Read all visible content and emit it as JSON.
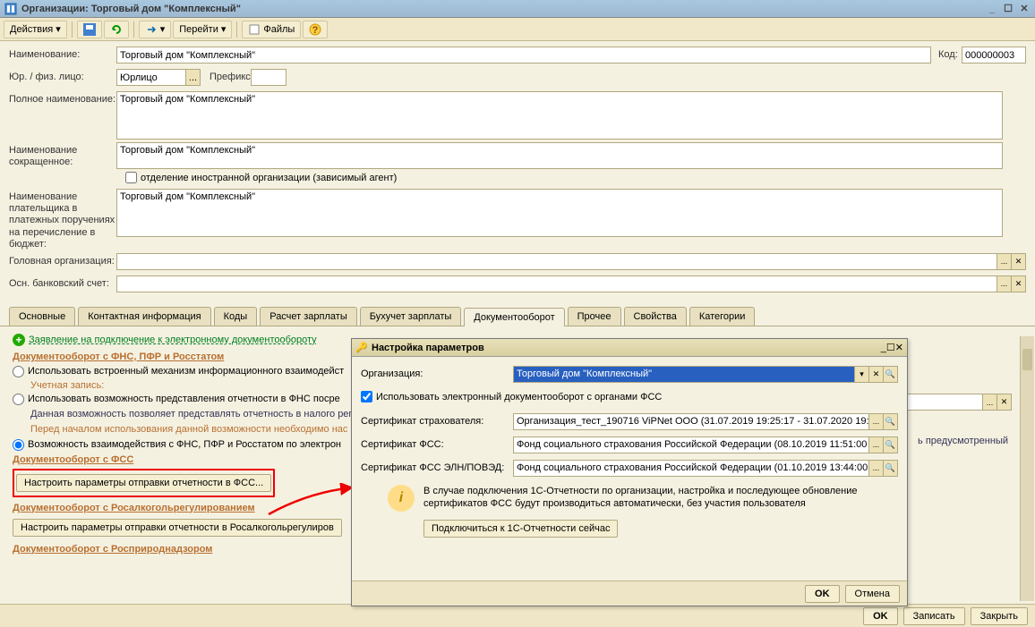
{
  "window": {
    "title": "Организации: Торговый дом \"Комплексный\""
  },
  "toolbar": {
    "actions": "Действия",
    "go": "Перейти",
    "files": "Файлы"
  },
  "form": {
    "name_label": "Наименование:",
    "name_value": "Торговый дом \"Комплексный\"",
    "code_label": "Код:",
    "code_value": "000000003",
    "person_label": "Юр. / физ. лицо:",
    "person_value": "Юрлицо",
    "prefix_label": "Префикс:",
    "prefix_value": "",
    "fullname_label": "Полное наименование:",
    "fullname_value": "Торговый дом \"Комплексный\"",
    "shortname_label": "Наименование сокращенное:",
    "shortname_value": "Торговый дом \"Комплексный\"",
    "foreign_cb": "отделение иностранной организации (зависимый агент)",
    "payer_label": "Наименование плательщика в платежных поручениях на перечисление в бюджет:",
    "payer_value": "Торговый дом \"Комплексный\"",
    "head_org_label": "Головная организация:",
    "bank_label": "Осн. банковский счет:"
  },
  "tabs": [
    "Основные",
    "Контактная информация",
    "Коды",
    "Расчет зарплаты",
    "Бухучет зарплаты",
    "Документооборот",
    "Прочее",
    "Свойства",
    "Категории"
  ],
  "active_tab": 5,
  "doc_tab": {
    "apply_link": "Заявление на подключение к электронному документообороту",
    "sec1": "Документооборот с ФНС, ПФР и Росстатом",
    "r1": "Использовать встроенный механизм информационного взаимодейст",
    "ucz_label": "Учетная запись:",
    "r2": "Использовать возможность представления отчетности в ФНС посре",
    "info1": "Данная возможность позволяет представлять отчетность в налого\nрегламентом документооборот.",
    "info2": "Перед началом использования данной возможности необходимо нас",
    "r3": "Возможность взаимодействия с ФНС, ПФР и Росстатом по электрон",
    "sec2": "Документооборот с ФСС",
    "btn_fss": "Настроить параметры отправки отчетности в ФСС...",
    "sec3": "Документооборот с Росалкогольрегулированием",
    "btn_alc": "Настроить параметры отправки отчетности в Росалкогольрегулиров",
    "sec4": "Документооборот с Росприроднадзором",
    "hint": "ь предусмотренный"
  },
  "modal": {
    "title": "Настройка параметров",
    "org_label": "Организация:",
    "org_value": "Торговый дом \"Комплексный\"",
    "use_edo": "Использовать электронный документооборот с органами ФСС",
    "cert1_label": "Сертификат страхователя:",
    "cert1_value": "Организация_тест_190716 ViPNet ООО (31.07.2019 19:25:17 - 31.07.2020 19:2",
    "cert2_label": "Сертификат ФСС:",
    "cert2_value": "Фонд социального страхования Российской Федерации (08.10.2019 11:51:00",
    "cert3_label": "Сертификат ФСС ЭЛН/ПОВЭД:",
    "cert3_value": "Фонд социального страхования Российской Федерации (01.10.2019 13:44:00",
    "info": "В случае подключения 1С-Отчетности по организации, настройка и последующее обновление сертификатов ФСС будут производиться автоматически, без участия пользователя",
    "connect_btn": "Подключиться к 1С-Отчетности сейчас",
    "ok": "OK",
    "cancel": "Отмена"
  },
  "footer": {
    "ok": "OK",
    "save": "Записать",
    "close": "Закрыть"
  }
}
